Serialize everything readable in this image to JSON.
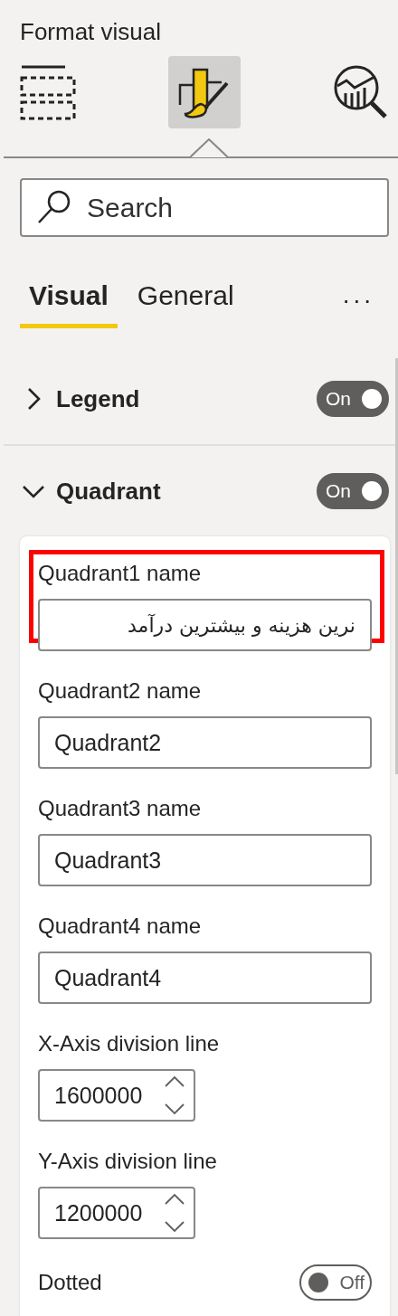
{
  "panel": {
    "title": "Format visual"
  },
  "pane_tabs": [
    {
      "kind": "fields",
      "selected": false
    },
    {
      "kind": "format",
      "selected": true
    },
    {
      "kind": "analytics",
      "selected": false
    }
  ],
  "search": {
    "placeholder": "Search"
  },
  "tabs": [
    {
      "label": "Visual",
      "selected": true
    },
    {
      "label": "General",
      "selected": false
    }
  ],
  "more_menu": "...",
  "sections": [
    {
      "label": "Legend",
      "expanded": false,
      "toggle": {
        "on": true,
        "label": "On"
      }
    },
    {
      "label": "Quadrant",
      "expanded": true,
      "toggle": {
        "on": true,
        "label": "On"
      }
    }
  ],
  "quadrant_settings": [
    {
      "kind": "text",
      "label": "Quadrant1 name",
      "value": "نرین هزینه و بیشترین درآمد",
      "rtl": true,
      "highlighted": true
    },
    {
      "kind": "text",
      "label": "Quadrant2 name",
      "value": "Quadrant2",
      "rtl": false,
      "highlighted": false
    },
    {
      "kind": "text",
      "label": "Quadrant3 name",
      "value": "Quadrant3",
      "rtl": false,
      "highlighted": false
    },
    {
      "kind": "text",
      "label": "Quadrant4 name",
      "value": "Quadrant4",
      "rtl": false,
      "highlighted": false
    },
    {
      "kind": "number",
      "label": "X-Axis division line",
      "value": "1600000",
      "highlighted": false
    },
    {
      "kind": "number",
      "label": "Y-Axis division line",
      "value": "1200000",
      "highlighted": false
    },
    {
      "kind": "toggle",
      "label": "Dotted",
      "on": false,
      "toggle_label": "Off",
      "highlighted": false
    }
  ]
}
